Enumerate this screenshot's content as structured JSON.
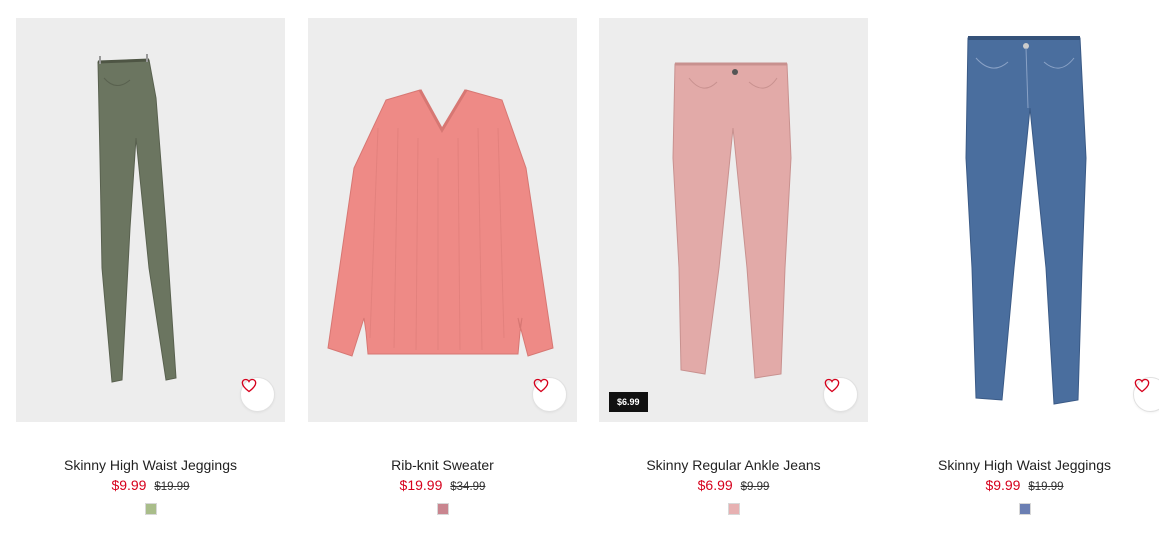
{
  "products": [
    {
      "title": "Skinny High Waist Jeggings",
      "price_now": "$9.99",
      "price_was": "$19.99",
      "swatch_color": "#a9bd8a",
      "garment_color": "#6b7560",
      "badge": "",
      "favorite_icon": "heart-icon"
    },
    {
      "title": "Rib-knit Sweater",
      "price_now": "$19.99",
      "price_was": "$34.99",
      "swatch_color": "#c9858f",
      "garment_color": "#ee8a86",
      "badge": "",
      "favorite_icon": "heart-icon"
    },
    {
      "title": "Skinny Regular Ankle Jeans",
      "price_now": "$6.99",
      "price_was": "$9.99",
      "swatch_color": "#e7b1b2",
      "garment_color": "#e2aaa8",
      "badge": "$6.99",
      "favorite_icon": "heart-icon"
    },
    {
      "title": "Skinny High Waist Jeggings",
      "price_now": "$9.99",
      "price_was": "$19.99",
      "swatch_color": "#6b7fb3",
      "garment_color": "#4a6e9e",
      "badge": "",
      "favorite_icon": "heart-icon"
    }
  ],
  "colors": {
    "sale_price": "#d6001c",
    "heart_icon": "#d6001c",
    "image_background": "#ededed"
  }
}
